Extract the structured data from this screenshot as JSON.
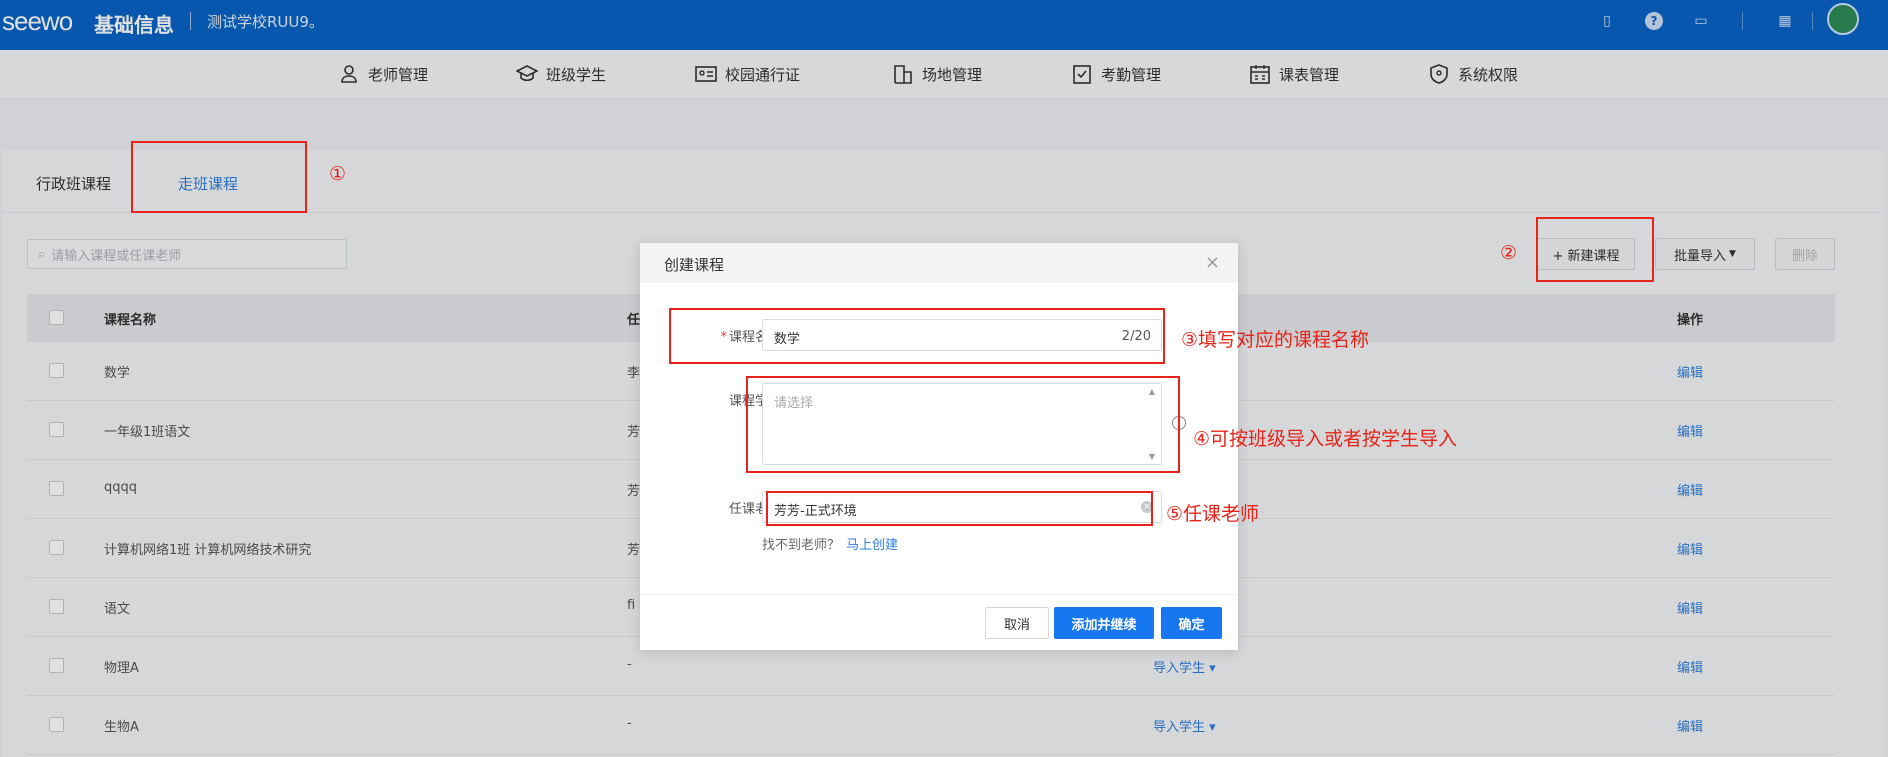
{
  "header": {
    "brand_en": "seewo",
    "brand_cn": "基础信息",
    "school": "测试学校RUU9。"
  },
  "nav": {
    "items": [
      {
        "label": "老师管理",
        "icon": "user-icon"
      },
      {
        "label": "班级学生",
        "icon": "graduation-cap-icon"
      },
      {
        "label": "校园通行证",
        "icon": "id-card-icon"
      },
      {
        "label": "场地管理",
        "icon": "building-icon"
      },
      {
        "label": "考勤管理",
        "icon": "clipboard-check-icon"
      },
      {
        "label": "课表管理",
        "icon": "calendar-icon"
      },
      {
        "label": "系统权限",
        "icon": "shield-icon"
      }
    ]
  },
  "tabs": {
    "admin": "行政班课程",
    "walk": "走班课程"
  },
  "toolbar": {
    "search_placeholder": "请输入课程或任课老师",
    "new_course": "+ 新建课程",
    "batch_import": "批量导入",
    "delete": "删除"
  },
  "table": {
    "headers": {
      "name": "课程名称",
      "teacher": "任",
      "action": "操作"
    },
    "rows": [
      {
        "name": "数学",
        "teacher": "李",
        "import": "",
        "action": "编辑"
      },
      {
        "name": "一年级1班语文",
        "teacher": "芳",
        "import": "",
        "action": "编辑"
      },
      {
        "name": "qqqq",
        "teacher": "芳",
        "import": "",
        "action": "编辑"
      },
      {
        "name": "计算机网络1班 计算机网络技术研究",
        "teacher": "芳",
        "import": "",
        "action": "编辑"
      },
      {
        "name": "语文",
        "teacher": "fi",
        "import": "",
        "action": "编辑"
      },
      {
        "name": "物理A",
        "teacher": "-",
        "import": "导入学生 ▾",
        "action": "编辑"
      },
      {
        "name": "生物A",
        "teacher": "-",
        "import": "导入学生 ▾",
        "action": "编辑"
      }
    ]
  },
  "modal": {
    "title": "创建课程",
    "close": "×",
    "course_name_label": "课程名称：",
    "course_name_value": "数学",
    "course_name_count": "2/20",
    "students_label": "课程学生：",
    "students_placeholder": "请选择",
    "teacher_label": "任课老师：",
    "teacher_value": "芳芳-正式环境",
    "hint_text": "找不到老师？",
    "hint_link": "马上创建",
    "cancel": "取消",
    "add_continue": "添加并继续",
    "confirm": "确定"
  },
  "annotations": {
    "a1": "①",
    "a2": "②",
    "a3": "③填写对应的课程名称",
    "a4": "④可按班级导入或者按学生导入",
    "a5": "⑤任课老师"
  },
  "colors": {
    "header_bg": "#0a63c6",
    "primary": "#1677f0",
    "annotation_red": "#e8231a"
  }
}
